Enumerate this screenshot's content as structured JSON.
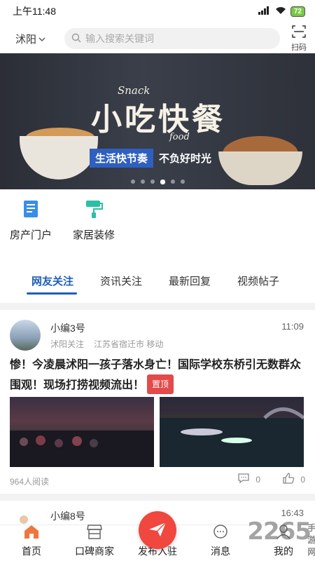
{
  "status_bar": {
    "time": "上午11:48",
    "battery": "72"
  },
  "header": {
    "city": "沭阳",
    "search_placeholder": "输入搜索关键词",
    "scan_label": "扫码"
  },
  "banner": {
    "snack": "Snack",
    "title": "小吃快餐",
    "food": "food",
    "slogan_a": "生活快节奏",
    "slogan_b": "不负好时光",
    "slides": 6,
    "active_slide": 4
  },
  "quick_links": [
    {
      "label": "房产门户",
      "icon": "building-icon",
      "color": "#3a8ee6"
    },
    {
      "label": "家居装修",
      "icon": "paint-roller-icon",
      "color": "#2bbfa4"
    }
  ],
  "tabs": [
    {
      "label": "网友关注",
      "active": true
    },
    {
      "label": "资讯关注",
      "active": false
    },
    {
      "label": "最新回复",
      "active": false
    },
    {
      "label": "视频帖子",
      "active": false
    }
  ],
  "post1": {
    "author": "小编3号",
    "section": "沭阳关注",
    "location": "江苏省宿迁市 移动",
    "time": "11:09",
    "title": "惨！今凌晨沭阳一孩子落水身亡！国际学校东桥引无数群众围观！现场打捞视频流出！",
    "pin": "置顶",
    "reads": "964人阅读",
    "comments": "0",
    "likes": "0"
  },
  "post2": {
    "author": "小编8号",
    "time": "16:43"
  },
  "bottom_nav": {
    "home": "首页",
    "merchants": "口碑商家",
    "publish": "发布入驻",
    "messages": "消息",
    "mine": "我的"
  },
  "watermark": {
    "text": "2265",
    "sub": "手游网"
  },
  "colors": {
    "accent": "#1f5fb6",
    "publish": "#f0473e",
    "pin": "#e34a4a"
  }
}
